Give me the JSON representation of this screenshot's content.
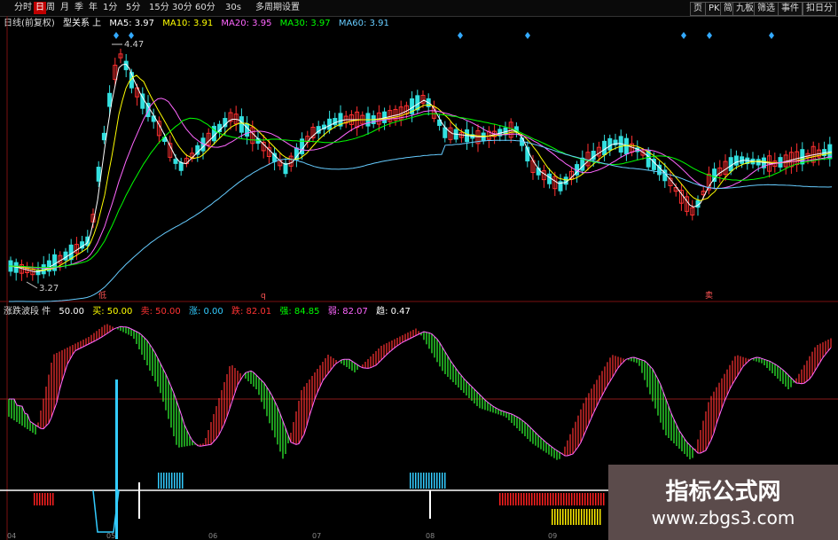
{
  "toolbar": {
    "left_items": [
      "分时",
      "日",
      "周",
      "月",
      "季",
      "年",
      "1分",
      "5分",
      "15分",
      "30分",
      "60分",
      "30s",
      "多周期",
      "设置"
    ],
    "active_index": 1,
    "right_items": [
      "页",
      "PK",
      "简",
      "九板",
      "筛选",
      "事件",
      "扣日分"
    ]
  },
  "price_pane": {
    "indicator_name": "日线(前复权)",
    "study_name": "型关系 上",
    "ma": [
      {
        "label": "MA5: 3.97",
        "color": "#ffffff"
      },
      {
        "label": "MA10: 3.91",
        "color": "#ffff00"
      },
      {
        "label": "MA20: 3.95",
        "color": "#ff66ff"
      },
      {
        "label": "MA30: 3.97",
        "color": "#00ff00"
      },
      {
        "label": "MA60: 3.91",
        "color": "#66ccff"
      }
    ],
    "high_label": "4.47",
    "low_label": "3.27",
    "markers": [
      "低",
      "q",
      "卖"
    ]
  },
  "indicator_pane": {
    "name": "涨跌波段 件",
    "values": [
      {
        "label": "50.00",
        "color": "#ffffff"
      },
      {
        "label": "买: 50.00",
        "color": "#ffff00"
      },
      {
        "label": "卖: 50.00",
        "color": "#ff3333"
      },
      {
        "label": "涨: 0.00",
        "color": "#33ccff"
      },
      {
        "label": "跌: 82.01",
        "color": "#ff3333"
      },
      {
        "label": "强: 84.85",
        "color": "#00ff00"
      },
      {
        "label": "弱: 82.07",
        "color": "#ff66ff"
      },
      {
        "label": "趋: 0.47",
        "color": "#ffffff"
      }
    ]
  },
  "date_axis": [
    "04",
    "05",
    "06",
    "07",
    "08",
    "09"
  ],
  "watermark": {
    "title": "指标公式网",
    "url": "www.zbgs3.com"
  }
}
